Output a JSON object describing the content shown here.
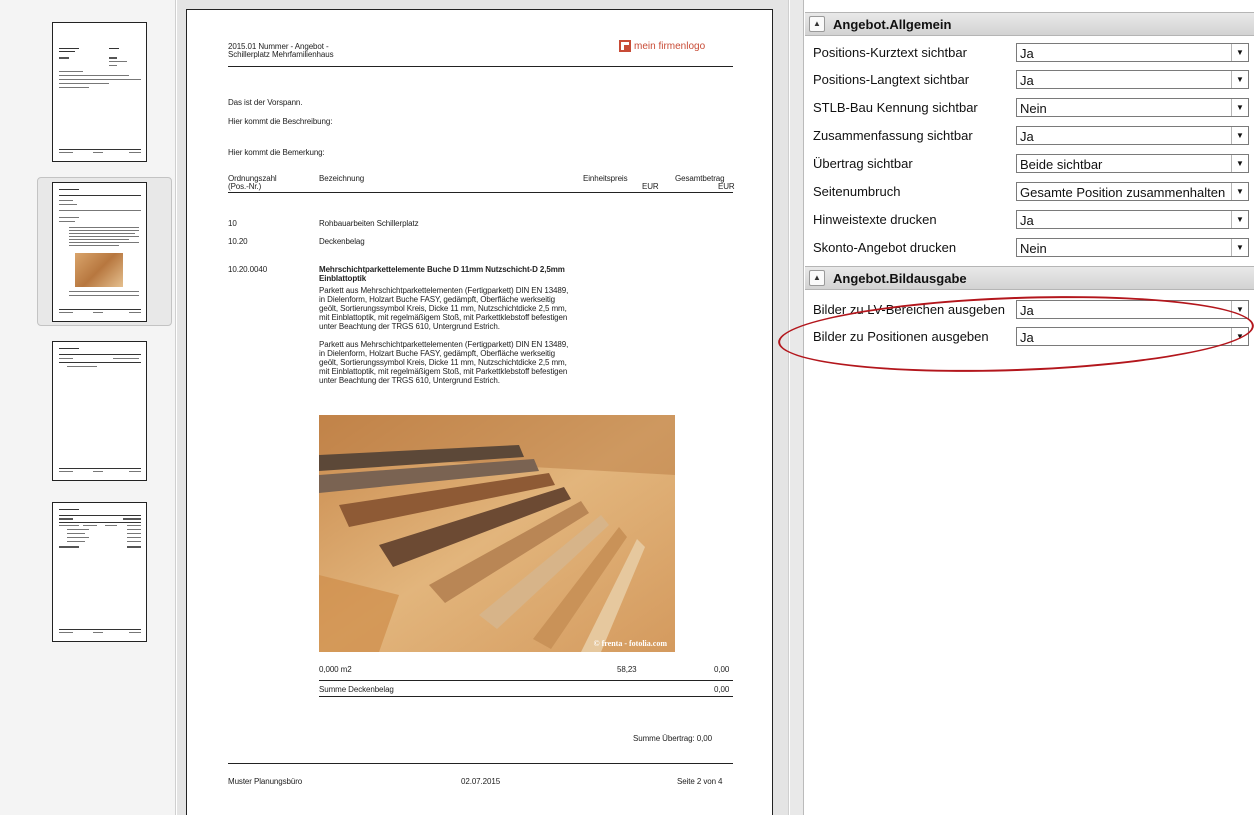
{
  "document": {
    "header_line1": "2015.01 Nummer - Angebot -",
    "header_line2": "Schillerplatz Mehrfamilienhaus",
    "logo_text": "mein firmenlogo",
    "vorspann": "Das ist der Vorspann.",
    "beschreibung": "Hier kommt die Beschreibung:",
    "bemerkung": "Hier kommt die Bemerkung:",
    "columns": {
      "oz_line1": "Ordnungszahl",
      "oz_line2": "(Pos.-Nr.)",
      "bezeichnung": "Bezeichnung",
      "ep_line1": "Einheitspreis",
      "ep_line2": "EUR",
      "gb_line1": "Gesamtbetrag",
      "gb_line2": "EUR"
    },
    "rows": [
      {
        "oz": "10",
        "text": "Rohbauarbeiten Schillerplatz"
      },
      {
        "oz": "10.20",
        "text": "Deckenbelag"
      }
    ],
    "position": {
      "oz": "10.20.0040",
      "title": "Mehrschichtparkettelemente Buche D 11mm Nutzschicht-D 2,5mm Einblattoptik",
      "longtext_a": "Parkett aus Mehrschichtparkettelementen (Fertigparkett) DIN EN 13489, in Dielenform, Holzart Buche FASY, gedämpft, Oberfläche werkseitig geölt, Sortierungssymbol Kreis, Dicke 11 mm, Nutzschichtdicke 2,5 mm, mit Einblattoptik, mit regelmäßigem Stoß, mit Parkettklebstoff befestigen unter Beachtung der TRGS 610, Untergrund Estrich.",
      "longtext_b": "Parkett aus Mehrschichtparkettelementen (Fertigparkett) DIN EN 13489, in Dielenform, Holzart Buche FASY, gedämpft, Oberfläche werkseitig geölt, Sortierungssymbol Kreis, Dicke 11 mm, Nutzschichtdicke 2,5 mm, mit Einblattoptik, mit regelmäßigem Stoß, mit Parkettklebstoff befestigen unter Beachtung der TRGS 610, Untergrund Estrich.",
      "photo_credit": "© frenta - fotolia.com",
      "qty": "0,000 m2",
      "unit_price": "58,23",
      "total": "0,00"
    },
    "sum_label": "Summe Deckenbelag",
    "sum_value": "0,00",
    "carry_over": "Summe Übertrag: 0,00",
    "footer_left": "Muster Planungsbüro",
    "footer_date": "02.07.2015",
    "footer_page": "Seite 2 von 4"
  },
  "sections": [
    {
      "title": "Angebot.Allgemein",
      "toggle_icon": "▲",
      "rows": [
        {
          "label": "Positions-Kurztext sichtbar",
          "value": "Ja"
        },
        {
          "label": "Positions-Langtext sichtbar",
          "value": "Ja"
        },
        {
          "label": "STLB-Bau Kennung sichtbar",
          "value": "Nein"
        },
        {
          "label": "Zusammenfassung sichtbar",
          "value": "Ja"
        },
        {
          "label": "Übertrag sichtbar",
          "value": "Beide sichtbar"
        },
        {
          "label": "Seitenumbruch",
          "value": "Gesamte Position zusammenhalten"
        },
        {
          "label": "Hinweistexte drucken",
          "value": "Ja"
        },
        {
          "label": "Skonto-Angebot drucken",
          "value": "Nein"
        }
      ]
    },
    {
      "title": "Angebot.Bildausgabe",
      "toggle_icon": "▲",
      "rows": [
        {
          "label": "Bilder zu LV-Bereichen ausgeben",
          "value": "Ja"
        },
        {
          "label": "Bilder zu Positionen ausgeben",
          "value": "Ja"
        }
      ]
    }
  ],
  "dropdown_icon": "▼",
  "colors": {
    "highlight": "#b3161c",
    "logo": "#c84b36"
  }
}
